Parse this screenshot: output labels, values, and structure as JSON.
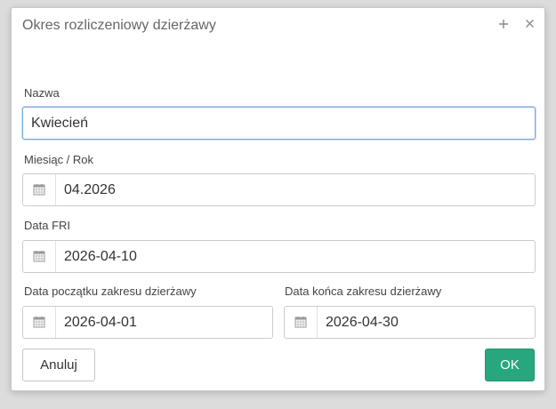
{
  "dialog": {
    "title": "Okres rozliczeniowy dzierżawy",
    "titlebar_buttons": {
      "expand_icon": "plus-icon",
      "close_icon": "close-icon"
    }
  },
  "form": {
    "name": {
      "label": "Nazwa",
      "value": "Kwiecień"
    },
    "month_year": {
      "label": "Miesiąc / Rok",
      "value": "04.2026",
      "icon": "calendar-icon"
    },
    "fri_date": {
      "label": "Data FRI",
      "value": "2026-04-10",
      "icon": "calendar-icon"
    },
    "range_start": {
      "label": "Data początku zakresu dzierżawy",
      "value": "2026-04-01",
      "icon": "calendar-icon"
    },
    "range_end": {
      "label": "Data końca zakresu dzierżawy",
      "value": "2026-04-30",
      "icon": "calendar-icon"
    }
  },
  "actions": {
    "cancel_label": "Anuluj",
    "ok_label": "OK"
  },
  "colors": {
    "ok_button": "#28a77e",
    "focus_border": "#7aa7e0"
  }
}
